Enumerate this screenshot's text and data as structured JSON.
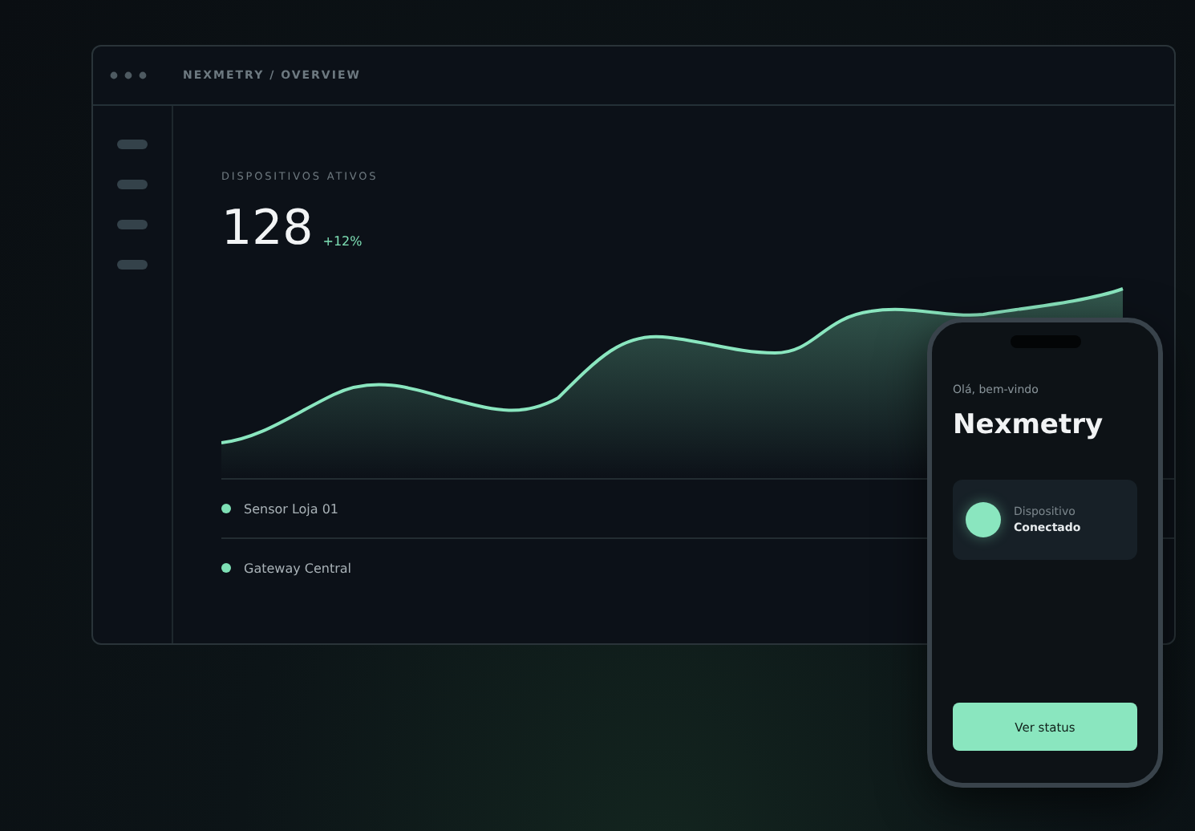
{
  "window": {
    "breadcrumb": "NEXMETRY / OVERVIEW"
  },
  "metric": {
    "label": "DISPOSITIVOS ATIVOS",
    "value": "128",
    "change": "+12%"
  },
  "devices": [
    {
      "name": "Sensor Loja 01"
    },
    {
      "name": "Gateway Central"
    }
  ],
  "phone": {
    "greeting": "Olá, bem-vindo",
    "title": "Nexmetry",
    "card": {
      "label": "Dispositivo",
      "status": "Conectado"
    },
    "button": "Ver status"
  }
}
